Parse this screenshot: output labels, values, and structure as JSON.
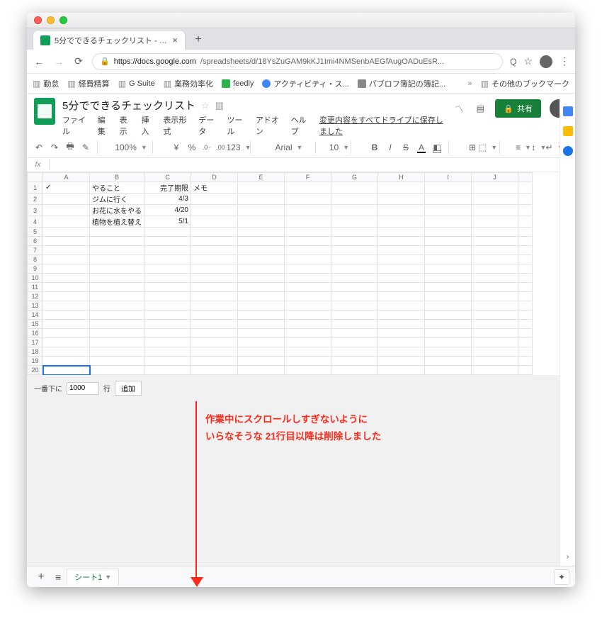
{
  "browser": {
    "tab_title": "5分でできるチェックリスト - Goo",
    "url_host": "https://docs.google.com",
    "url_path": "/spreadsheets/d/18YsZuGAM9kKJ1Imi4NMSenbAEGfAugOADuEsR...",
    "bookmarks": [
      {
        "label": "勤怠",
        "kind": "folder"
      },
      {
        "label": "経費精算",
        "kind": "folder"
      },
      {
        "label": "G Suite",
        "kind": "folder"
      },
      {
        "label": "業務効率化",
        "kind": "folder"
      },
      {
        "label": "feedly",
        "kind": "fav",
        "color": "#2bb24c"
      },
      {
        "label": "アクティビティ・ス...",
        "kind": "fav",
        "color": "#4285f4"
      },
      {
        "label": "パブロフ簿記の簿記...",
        "kind": "fav",
        "color": "#888"
      }
    ],
    "other_bookmarks": "その他のブックマーク"
  },
  "doc": {
    "title": "5分でできるチェックリスト",
    "menus": [
      "ファイル",
      "編集",
      "表示",
      "挿入",
      "表示形式",
      "データ",
      "ツール",
      "アドオン",
      "ヘルプ"
    ],
    "save_status": "変更内容をすべてドライブに保存しました",
    "share_label": "共有"
  },
  "toolbar": {
    "zoom": "100%",
    "currency": "¥",
    "pct": "%",
    "dec_dec": ".0",
    "dec_inc": ".00",
    "numfmt": "123",
    "font": "Arial",
    "font_size": "10"
  },
  "fx": {
    "label": "fx"
  },
  "columns": [
    "A",
    "B",
    "C",
    "D",
    "E",
    "F",
    "G",
    "H",
    "I",
    "J"
  ],
  "rows": [
    {
      "n": "1",
      "A": "✓",
      "B": "やること",
      "C": "完了期限",
      "D": "メモ"
    },
    {
      "n": "2",
      "A": "",
      "B": "ジムに行く",
      "C": "4/3",
      "D": ""
    },
    {
      "n": "3",
      "A": "",
      "B": "お花に水をやる",
      "C": "4/20",
      "D": ""
    },
    {
      "n": "4",
      "A": "",
      "B": "植物を植え替え",
      "C": "5/1",
      "D": ""
    },
    {
      "n": "5"
    },
    {
      "n": "6"
    },
    {
      "n": "7"
    },
    {
      "n": "8"
    },
    {
      "n": "9"
    },
    {
      "n": "10"
    },
    {
      "n": "11"
    },
    {
      "n": "12"
    },
    {
      "n": "13"
    },
    {
      "n": "14"
    },
    {
      "n": "15"
    },
    {
      "n": "16"
    },
    {
      "n": "17"
    },
    {
      "n": "18"
    },
    {
      "n": "19"
    },
    {
      "n": "20"
    }
  ],
  "addrows": {
    "prefix": "一番下に",
    "value": "1000",
    "unit": "行",
    "button": "追加"
  },
  "annotation": {
    "line1": "作業中にスクロールしすぎないように",
    "line2": "いらなそうな 21行目以降は削除しました"
  },
  "sheet_tab": "シート1"
}
